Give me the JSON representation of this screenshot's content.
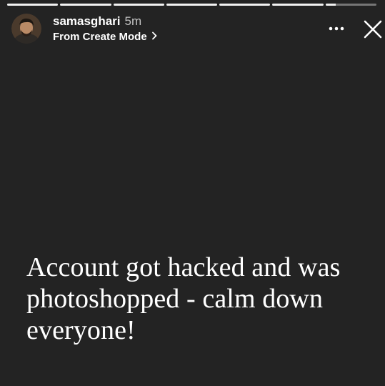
{
  "progress": {
    "segments": [
      1,
      1,
      1,
      1,
      1,
      1,
      0.2
    ]
  },
  "header": {
    "username": "samasghari",
    "time": "5m",
    "source": "From Create Mode"
  },
  "caption": {
    "lines": [
      "Account got hacked and was",
      "photoshopped - calm down",
      "everyone!"
    ]
  },
  "icons": {
    "more": "more-options-icon",
    "close": "close-icon",
    "chevron": "chevron-right-icon"
  },
  "colors": {
    "background": "#232323",
    "text": "#ffffff"
  }
}
